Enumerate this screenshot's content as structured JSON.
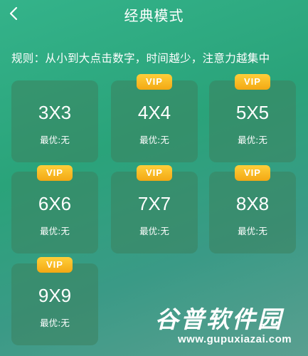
{
  "header": {
    "back_icon": "chevron-left-icon",
    "title": "经典模式"
  },
  "rules": "规则：从小到大点击数字，时间越少，注意力越集中",
  "colors": {
    "vip_badge": "#f5b21d",
    "card_bg": "#3f8a64"
  },
  "cards": [
    {
      "size": "3X3",
      "vip": "",
      "best": "最优:无"
    },
    {
      "size": "4X4",
      "vip": "VIP",
      "best": "最优:无"
    },
    {
      "size": "5X5",
      "vip": "VIP",
      "best": "最优:无"
    },
    {
      "size": "6X6",
      "vip": "VIP",
      "best": "最优:无"
    },
    {
      "size": "7X7",
      "vip": "VIP",
      "best": "最优:无"
    },
    {
      "size": "8X8",
      "vip": "VIP",
      "best": "最优:无"
    },
    {
      "size": "9X9",
      "vip": "VIP",
      "best": "最优:无"
    }
  ],
  "watermark": {
    "text": "谷普软件园",
    "url": "www.gupuxiazai.com"
  }
}
